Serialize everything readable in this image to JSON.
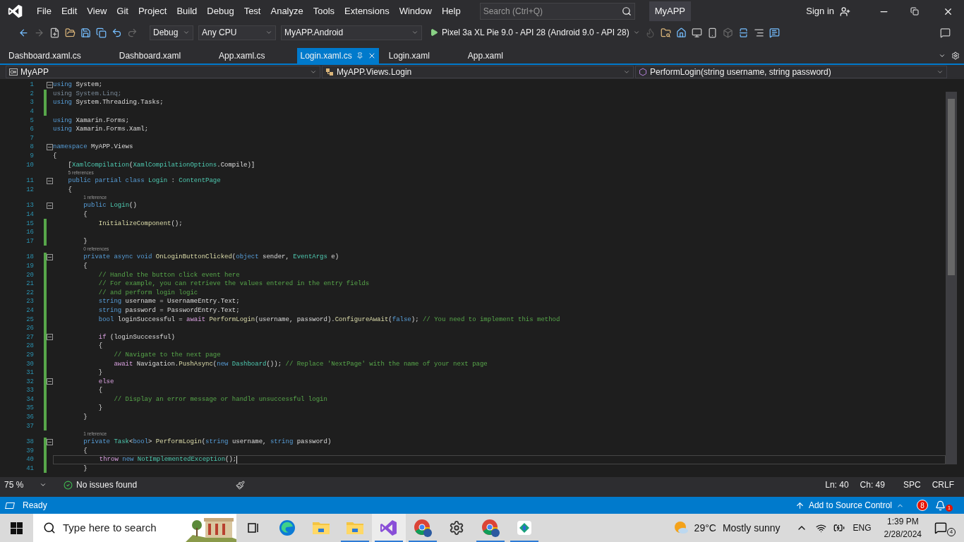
{
  "menu": {
    "items": [
      "File",
      "Edit",
      "View",
      "Git",
      "Project",
      "Build",
      "Debug",
      "Test",
      "Analyze",
      "Tools",
      "Extensions",
      "Window",
      "Help"
    ]
  },
  "search": {
    "placeholder": "Search (Ctrl+Q)"
  },
  "solution_name": "MyAPP",
  "account": {
    "label": "Sign in"
  },
  "toolbar": {
    "configuration": "Debug",
    "platform": "Any CPU",
    "startup_project": "MyAPP.Android",
    "run_target": "Pixel 3a XL Pie 9.0 - API 28 (Android 9.0 - API 28)"
  },
  "tabs": [
    {
      "label": "Dashboard.xaml.cs",
      "selected": false
    },
    {
      "label": "Dashboard.xaml",
      "selected": false
    },
    {
      "label": "App.xaml.cs",
      "selected": false
    },
    {
      "label": "Login.xaml.cs",
      "selected": true
    },
    {
      "label": "Login.xaml",
      "selected": false
    },
    {
      "label": "App.xaml",
      "selected": false
    }
  ],
  "nav_bar": {
    "project": "MyAPP",
    "type": "MyAPP.Views.Login",
    "member": "PerformLogin(string username, string password)"
  },
  "code": {
    "lines": [
      {
        "number": "1",
        "fold": true,
        "changed": false,
        "current": false,
        "tokens": [
          {
            "kind": "kw",
            "text": "using"
          },
          {
            "kind": "tx",
            "text": " System;"
          }
        ]
      },
      {
        "number": "2",
        "fold": false,
        "changed": true,
        "current": false,
        "tokens": [
          {
            "kind": "dim",
            "text": "using System.Linq;"
          }
        ]
      },
      {
        "number": "3",
        "fold": false,
        "changed": true,
        "current": false,
        "tokens": [
          {
            "kind": "kw",
            "text": "using"
          },
          {
            "kind": "tx",
            "text": " System.Threading.Tasks;"
          }
        ]
      },
      {
        "number": "4",
        "fold": false,
        "changed": true,
        "current": false
      },
      {
        "number": "5",
        "fold": false,
        "changed": false,
        "current": false,
        "tokens": [
          {
            "kind": "kw",
            "text": "using"
          },
          {
            "kind": "tx",
            "text": " Xamarin.Forms;"
          }
        ]
      },
      {
        "number": "6",
        "fold": false,
        "changed": false,
        "current": false,
        "tokens": [
          {
            "kind": "kw",
            "text": "using"
          },
          {
            "kind": "tx",
            "text": " Xamarin.Forms.Xaml;"
          }
        ]
      },
      {
        "number": "7",
        "fold": false,
        "changed": false,
        "current": false
      },
      {
        "number": "8",
        "fold": true,
        "changed": false,
        "current": false,
        "tokens": [
          {
            "kind": "kw",
            "text": "namespace"
          },
          {
            "kind": "tx",
            "text": " MyAPP.Views"
          }
        ]
      },
      {
        "number": "9",
        "fold": false,
        "changed": false,
        "current": false,
        "tokens": [
          {
            "kind": "tx",
            "text": "{"
          }
        ]
      },
      {
        "number": "10",
        "fold": false,
        "changed": false,
        "current": false,
        "tokens": [
          {
            "kind": "tx",
            "text": "    ["
          },
          {
            "kind": "type",
            "text": "XamlCompilation"
          },
          {
            "kind": "tx",
            "text": "("
          },
          {
            "kind": "type",
            "text": "XamlCompilationOptions"
          },
          {
            "kind": "tx",
            "text": ".Compile)]"
          }
        ]
      },
      {
        "number": "11",
        "codelens": "5 references",
        "fold": true,
        "changed": false,
        "current": false,
        "tokens": [
          {
            "kind": "kw",
            "text": "    public partial class"
          },
          {
            "kind": "type",
            "text": " Login"
          },
          {
            "kind": "tx",
            "text": " : "
          },
          {
            "kind": "type",
            "text": "ContentPage"
          }
        ]
      },
      {
        "number": "12",
        "fold": false,
        "changed": false,
        "current": false,
        "tokens": [
          {
            "kind": "tx",
            "text": "    {"
          }
        ]
      },
      {
        "number": "13",
        "codelens": "1 reference",
        "fold": true,
        "changed": false,
        "current": false,
        "tokens": [
          {
            "kind": "kw",
            "text": "        public"
          },
          {
            "kind": "type",
            "text": " Login"
          },
          {
            "kind": "tx",
            "text": "()"
          }
        ]
      },
      {
        "number": "14",
        "fold": false,
        "changed": false,
        "current": false,
        "tokens": [
          {
            "kind": "tx",
            "text": "        {"
          }
        ]
      },
      {
        "number": "15",
        "fold": false,
        "changed": true,
        "current": false,
        "tokens": [
          {
            "kind": "fn",
            "text": "            InitializeComponent"
          },
          {
            "kind": "tx",
            "text": "();"
          }
        ]
      },
      {
        "number": "16",
        "fold": false,
        "changed": true,
        "current": false
      },
      {
        "number": "17",
        "fold": false,
        "changed": true,
        "current": false,
        "tokens": [
          {
            "kind": "tx",
            "text": "        }"
          }
        ]
      },
      {
        "number": "18",
        "codelens": "0 references",
        "fold": true,
        "changed": true,
        "current": false,
        "tokens": [
          {
            "kind": "kw",
            "text": "        private async void"
          },
          {
            "kind": "fn",
            "text": " OnLoginButtonClicked"
          },
          {
            "kind": "tx",
            "text": "("
          },
          {
            "kind": "kw",
            "text": "object"
          },
          {
            "kind": "tx",
            "text": " sender, "
          },
          {
            "kind": "type",
            "text": "EventArgs"
          },
          {
            "kind": "tx",
            "text": " e)"
          }
        ]
      },
      {
        "number": "19",
        "fold": false,
        "changed": true,
        "current": false,
        "tokens": [
          {
            "kind": "tx",
            "text": "        {"
          }
        ]
      },
      {
        "number": "20",
        "fold": false,
        "changed": true,
        "current": false,
        "tokens": [
          {
            "kind": "cm",
            "text": "            // Handle the button click event here"
          }
        ]
      },
      {
        "number": "21",
        "fold": false,
        "changed": true,
        "current": false,
        "tokens": [
          {
            "kind": "cm",
            "text": "            // For example, you can retrieve the values entered in the entry fields"
          }
        ]
      },
      {
        "number": "22",
        "fold": false,
        "changed": true,
        "current": false,
        "tokens": [
          {
            "kind": "cm",
            "text": "            // and perform login logic"
          }
        ]
      },
      {
        "number": "23",
        "fold": false,
        "changed": true,
        "current": false,
        "tokens": [
          {
            "kind": "kw",
            "text": "            string"
          },
          {
            "kind": "tx",
            "text": " username = UsernameEntry.Text;"
          }
        ]
      },
      {
        "number": "24",
        "fold": false,
        "changed": true,
        "current": false,
        "tokens": [
          {
            "kind": "kw",
            "text": "            string"
          },
          {
            "kind": "tx",
            "text": " password = PasswordEntry.Text;"
          }
        ]
      },
      {
        "number": "25",
        "fold": false,
        "changed": true,
        "current": false,
        "tokens": [
          {
            "kind": "kw",
            "text": "            bool"
          },
          {
            "kind": "tx",
            "text": " loginSuccessful = "
          },
          {
            "kind": "ctl",
            "text": "await"
          },
          {
            "kind": "fn",
            "text": " PerformLogin"
          },
          {
            "kind": "tx",
            "text": "(username, password)."
          },
          {
            "kind": "fn",
            "text": "ConfigureAwait"
          },
          {
            "kind": "tx",
            "text": "("
          },
          {
            "kind": "kw",
            "text": "false"
          },
          {
            "kind": "tx",
            "text": "); "
          },
          {
            "kind": "cm",
            "text": "// You need to implement this method"
          }
        ]
      },
      {
        "number": "26",
        "fold": false,
        "changed": true,
        "current": false
      },
      {
        "number": "27",
        "fold": true,
        "changed": true,
        "current": false,
        "tokens": [
          {
            "kind": "ctl",
            "text": "            if"
          },
          {
            "kind": "tx",
            "text": " (loginSuccessful)"
          }
        ]
      },
      {
        "number": "28",
        "fold": false,
        "changed": true,
        "current": false,
        "tokens": [
          {
            "kind": "tx",
            "text": "            {"
          }
        ]
      },
      {
        "number": "29",
        "fold": false,
        "changed": true,
        "current": false,
        "tokens": [
          {
            "kind": "cm",
            "text": "                // Navigate to the next page"
          }
        ]
      },
      {
        "number": "30",
        "fold": false,
        "changed": true,
        "current": false,
        "tokens": [
          {
            "kind": "ctl",
            "text": "                await"
          },
          {
            "kind": "tx",
            "text": " Navigation."
          },
          {
            "kind": "fn",
            "text": "PushAsync"
          },
          {
            "kind": "tx",
            "text": "("
          },
          {
            "kind": "kw",
            "text": "new"
          },
          {
            "kind": "type",
            "text": " Dashboard"
          },
          {
            "kind": "tx",
            "text": "()); "
          },
          {
            "kind": "cm",
            "text": "// Replace 'NextPage' with the name of your next page"
          }
        ]
      },
      {
        "number": "31",
        "fold": false,
        "changed": true,
        "current": false,
        "tokens": [
          {
            "kind": "tx",
            "text": "            }"
          }
        ]
      },
      {
        "number": "32",
        "fold": true,
        "changed": true,
        "current": false,
        "tokens": [
          {
            "kind": "ctl",
            "text": "            else"
          }
        ]
      },
      {
        "number": "33",
        "fold": false,
        "changed": true,
        "current": false,
        "tokens": [
          {
            "kind": "tx",
            "text": "            {"
          }
        ]
      },
      {
        "number": "34",
        "fold": false,
        "changed": true,
        "current": false,
        "tokens": [
          {
            "kind": "cm",
            "text": "                // Display an error message or handle unsuccessful login"
          }
        ]
      },
      {
        "number": "35",
        "fold": false,
        "changed": true,
        "current": false,
        "tokens": [
          {
            "kind": "tx",
            "text": "            }"
          }
        ]
      },
      {
        "number": "36",
        "fold": false,
        "changed": true,
        "current": false,
        "tokens": [
          {
            "kind": "tx",
            "text": "        }"
          }
        ]
      },
      {
        "number": "37",
        "fold": false,
        "changed": true,
        "current": false
      },
      {
        "number": "38",
        "codelens": "1 reference",
        "fold": true,
        "changed": true,
        "current": false,
        "tokens": [
          {
            "kind": "kw",
            "text": "        private"
          },
          {
            "kind": "type",
            "text": " Task"
          },
          {
            "kind": "tx",
            "text": "<"
          },
          {
            "kind": "kw",
            "text": "bool"
          },
          {
            "kind": "tx",
            "text": "> "
          },
          {
            "kind": "fn",
            "text": "PerformLogin"
          },
          {
            "kind": "tx",
            "text": "("
          },
          {
            "kind": "kw",
            "text": "string"
          },
          {
            "kind": "tx",
            "text": " username, "
          },
          {
            "kind": "kw",
            "text": "string"
          },
          {
            "kind": "tx",
            "text": " password)"
          }
        ]
      },
      {
        "number": "39",
        "fold": false,
        "changed": true,
        "current": false,
        "tokens": [
          {
            "kind": "tx",
            "text": "        {"
          }
        ]
      },
      {
        "number": "40",
        "fold": false,
        "changed": true,
        "current": true,
        "tokens": [
          {
            "kind": "ctl",
            "text": "            throw"
          },
          {
            "kind": "kw",
            "text": " new"
          },
          {
            "kind": "type",
            "text": " NotImplementedException"
          },
          {
            "kind": "tx",
            "text": "();"
          }
        ]
      },
      {
        "number": "41",
        "fold": false,
        "changed": true,
        "current": false,
        "tokens": [
          {
            "kind": "tx",
            "text": "        }"
          }
        ]
      }
    ]
  },
  "editor_status": {
    "zoom": "75 %",
    "issues": "No issues found",
    "line": "Ln: 40",
    "column": "Ch: 49",
    "whitespace": "SPC",
    "line_ending": "CRLF"
  },
  "status_bar": {
    "state": "Ready",
    "source_control": "Add to Source Control",
    "errors_badge": "8",
    "notifications_badge": "1"
  },
  "taskbar": {
    "search_placeholder": "Type here to search",
    "apps": [
      {
        "kind": "task-view",
        "selected": false,
        "running": false
      },
      {
        "kind": "edge",
        "selected": false,
        "running": false
      },
      {
        "kind": "folder",
        "selected": false,
        "running": false
      },
      {
        "kind": "folder",
        "selected": false,
        "running": true
      },
      {
        "kind": "visual-studio",
        "selected": true,
        "running": true
      },
      {
        "kind": "chrome",
        "selected": false,
        "running": true
      },
      {
        "kind": "settings",
        "selected": false,
        "running": false
      },
      {
        "kind": "chrome",
        "selected": false,
        "running": true
      },
      {
        "kind": "app",
        "selected": false,
        "running": true
      }
    ],
    "weather": {
      "temperature": "29°C",
      "condition": "Mostly sunny"
    },
    "language": "ENG",
    "time": "1:39 PM",
    "date": "2/28/2024",
    "action_center_badge": "4"
  }
}
